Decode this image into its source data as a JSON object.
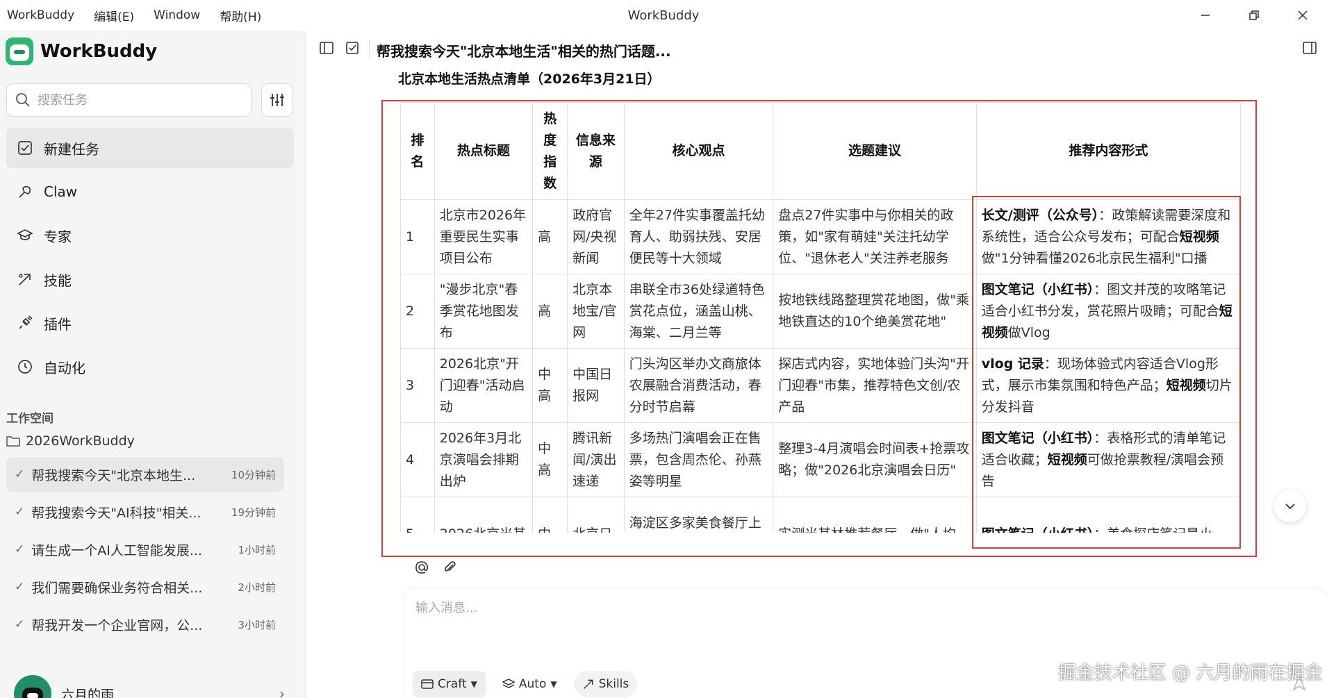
{
  "app": {
    "name": "WorkBuddy",
    "window_title": "WorkBuddy",
    "menu": [
      "WorkBuddy",
      "编辑(E)",
      "Window",
      "帮助(H)"
    ]
  },
  "sidebar": {
    "search_placeholder": "搜索任务",
    "nav": [
      {
        "label": "新建任务",
        "icon": "new-task-icon"
      },
      {
        "label": "Claw",
        "icon": "claw-icon"
      },
      {
        "label": "专家",
        "icon": "graduation-cap-icon"
      },
      {
        "label": "技能",
        "icon": "skill-icon"
      },
      {
        "label": "插件",
        "icon": "plug-icon"
      },
      {
        "label": "自动化",
        "icon": "clock-icon"
      }
    ],
    "workspace_header": "工作空间",
    "workspace_folder": "2026WorkBuddy",
    "tasks": [
      {
        "title": "帮我搜索今天\"北京本地生...",
        "time": "10分钟前"
      },
      {
        "title": "帮我搜索今天\"AI科技\"相关...",
        "time": "19分钟前"
      },
      {
        "title": "请生成一个AI人工智能发展...",
        "time": "1小时前"
      },
      {
        "title": "我们需要确保业务符合相关...",
        "time": "2小时前"
      },
      {
        "title": "帮我开发一个企业官网，公...",
        "time": "3小时前"
      }
    ],
    "user": {
      "name": "六月的雨"
    }
  },
  "main": {
    "chat_title": "帮我搜索今天\"北京本地生活\"相关的热门话题...",
    "table_title": "北京本地生活热点清单（2026年3月21日）",
    "table": {
      "headers": [
        "排名",
        "热点标题",
        "热度指数",
        "信息来源",
        "核心观点",
        "选题建议",
        "推荐内容形式"
      ],
      "rows": [
        {
          "rank": "1",
          "title": "北京市2026年重要民生实事项目公布",
          "heat": "高",
          "source": "政府官网/央视新闻",
          "view": "全年27件实事覆盖托幼育人、助弱扶残、安居便民等十大领域",
          "suggest": "盘点27件实事中与你相关的政策，如\"家有萌娃\"关注托幼学位、\"退休老人\"关注养老服务",
          "format_bold1": "长文/测评（公众号）",
          "format_text1": "：政策解读需要深度和系统性，适合公众号发布；可配合",
          "format_bold2": "短视频",
          "format_text2": "做\"1分钟看懂2026北京民生福利\"口播"
        },
        {
          "rank": "2",
          "title": "\"漫步北京\"春季赏花地图发布",
          "heat": "高",
          "source": "北京本地宝/官网",
          "view": "串联全市36处绿道特色赏花点位，涵盖山桃、海棠、二月兰等",
          "suggest": "按地铁线路整理赏花地图，做\"乘地铁直达的10个绝美赏花地\"",
          "format_bold1": "图文笔记（小红书）",
          "format_text1": "：图文并茂的攻略笔记适合小红书分发，赏花照片吸睛；可配合",
          "format_bold2": "短视频",
          "format_text2": "做Vlog"
        },
        {
          "rank": "3",
          "title": "2026北京\"开门迎春\"活动启动",
          "heat": "中高",
          "source": "中国日报网",
          "view": "门头沟区举办文商旅体农展融合消费活动，春分时节启幕",
          "suggest": "探店式内容，实地体验门头沟\"开门迎春\"市集，推荐特色文创/农产品",
          "format_bold1": "vlog 记录",
          "format_text1": "：现场体验式内容适合Vlog形式，展示市集氛围和特色产品；",
          "format_bold2": "短视频",
          "format_text2": "切片分发抖音"
        },
        {
          "rank": "4",
          "title": "2026年3月北京演唱会排期出炉",
          "heat": "中高",
          "source": "腾讯新闻/演出速递",
          "view": "多场热门演唱会正在售票，包含周杰伦、孙燕姿等明星",
          "suggest": "整理3-4月演唱会时间表+抢票攻略；做\"2026北京演唱会日历\"",
          "format_bold1": "图文笔记（小红书）",
          "format_text1": "：表格形式的清单笔记适合收藏；",
          "format_bold2": "短视频",
          "format_text2": "可做抢票教程/演唱会预告"
        },
        {
          "rank": "5",
          "title": "2026北京米其",
          "heat": "中",
          "source": "北京日",
          "view": "海淀区多家美食餐厅上榜",
          "suggest": "实测米其林推荐餐厅，做\"人均",
          "format_bold1": "图文笔记（小红书）",
          "format_text1": "：美食探店笔记是小",
          "format_bold2": "",
          "format_text2": ""
        }
      ]
    },
    "composer": {
      "placeholder": "输入消息...",
      "chips": [
        "Craft",
        "Auto",
        "Skills"
      ]
    }
  },
  "watermark": "掘金技术社区 @ 六月的雨在掘金",
  "colors": {
    "accent_green": "#2bb673",
    "highlight_red": "#e53935",
    "sidebar_bg": "#f5f5f5"
  }
}
